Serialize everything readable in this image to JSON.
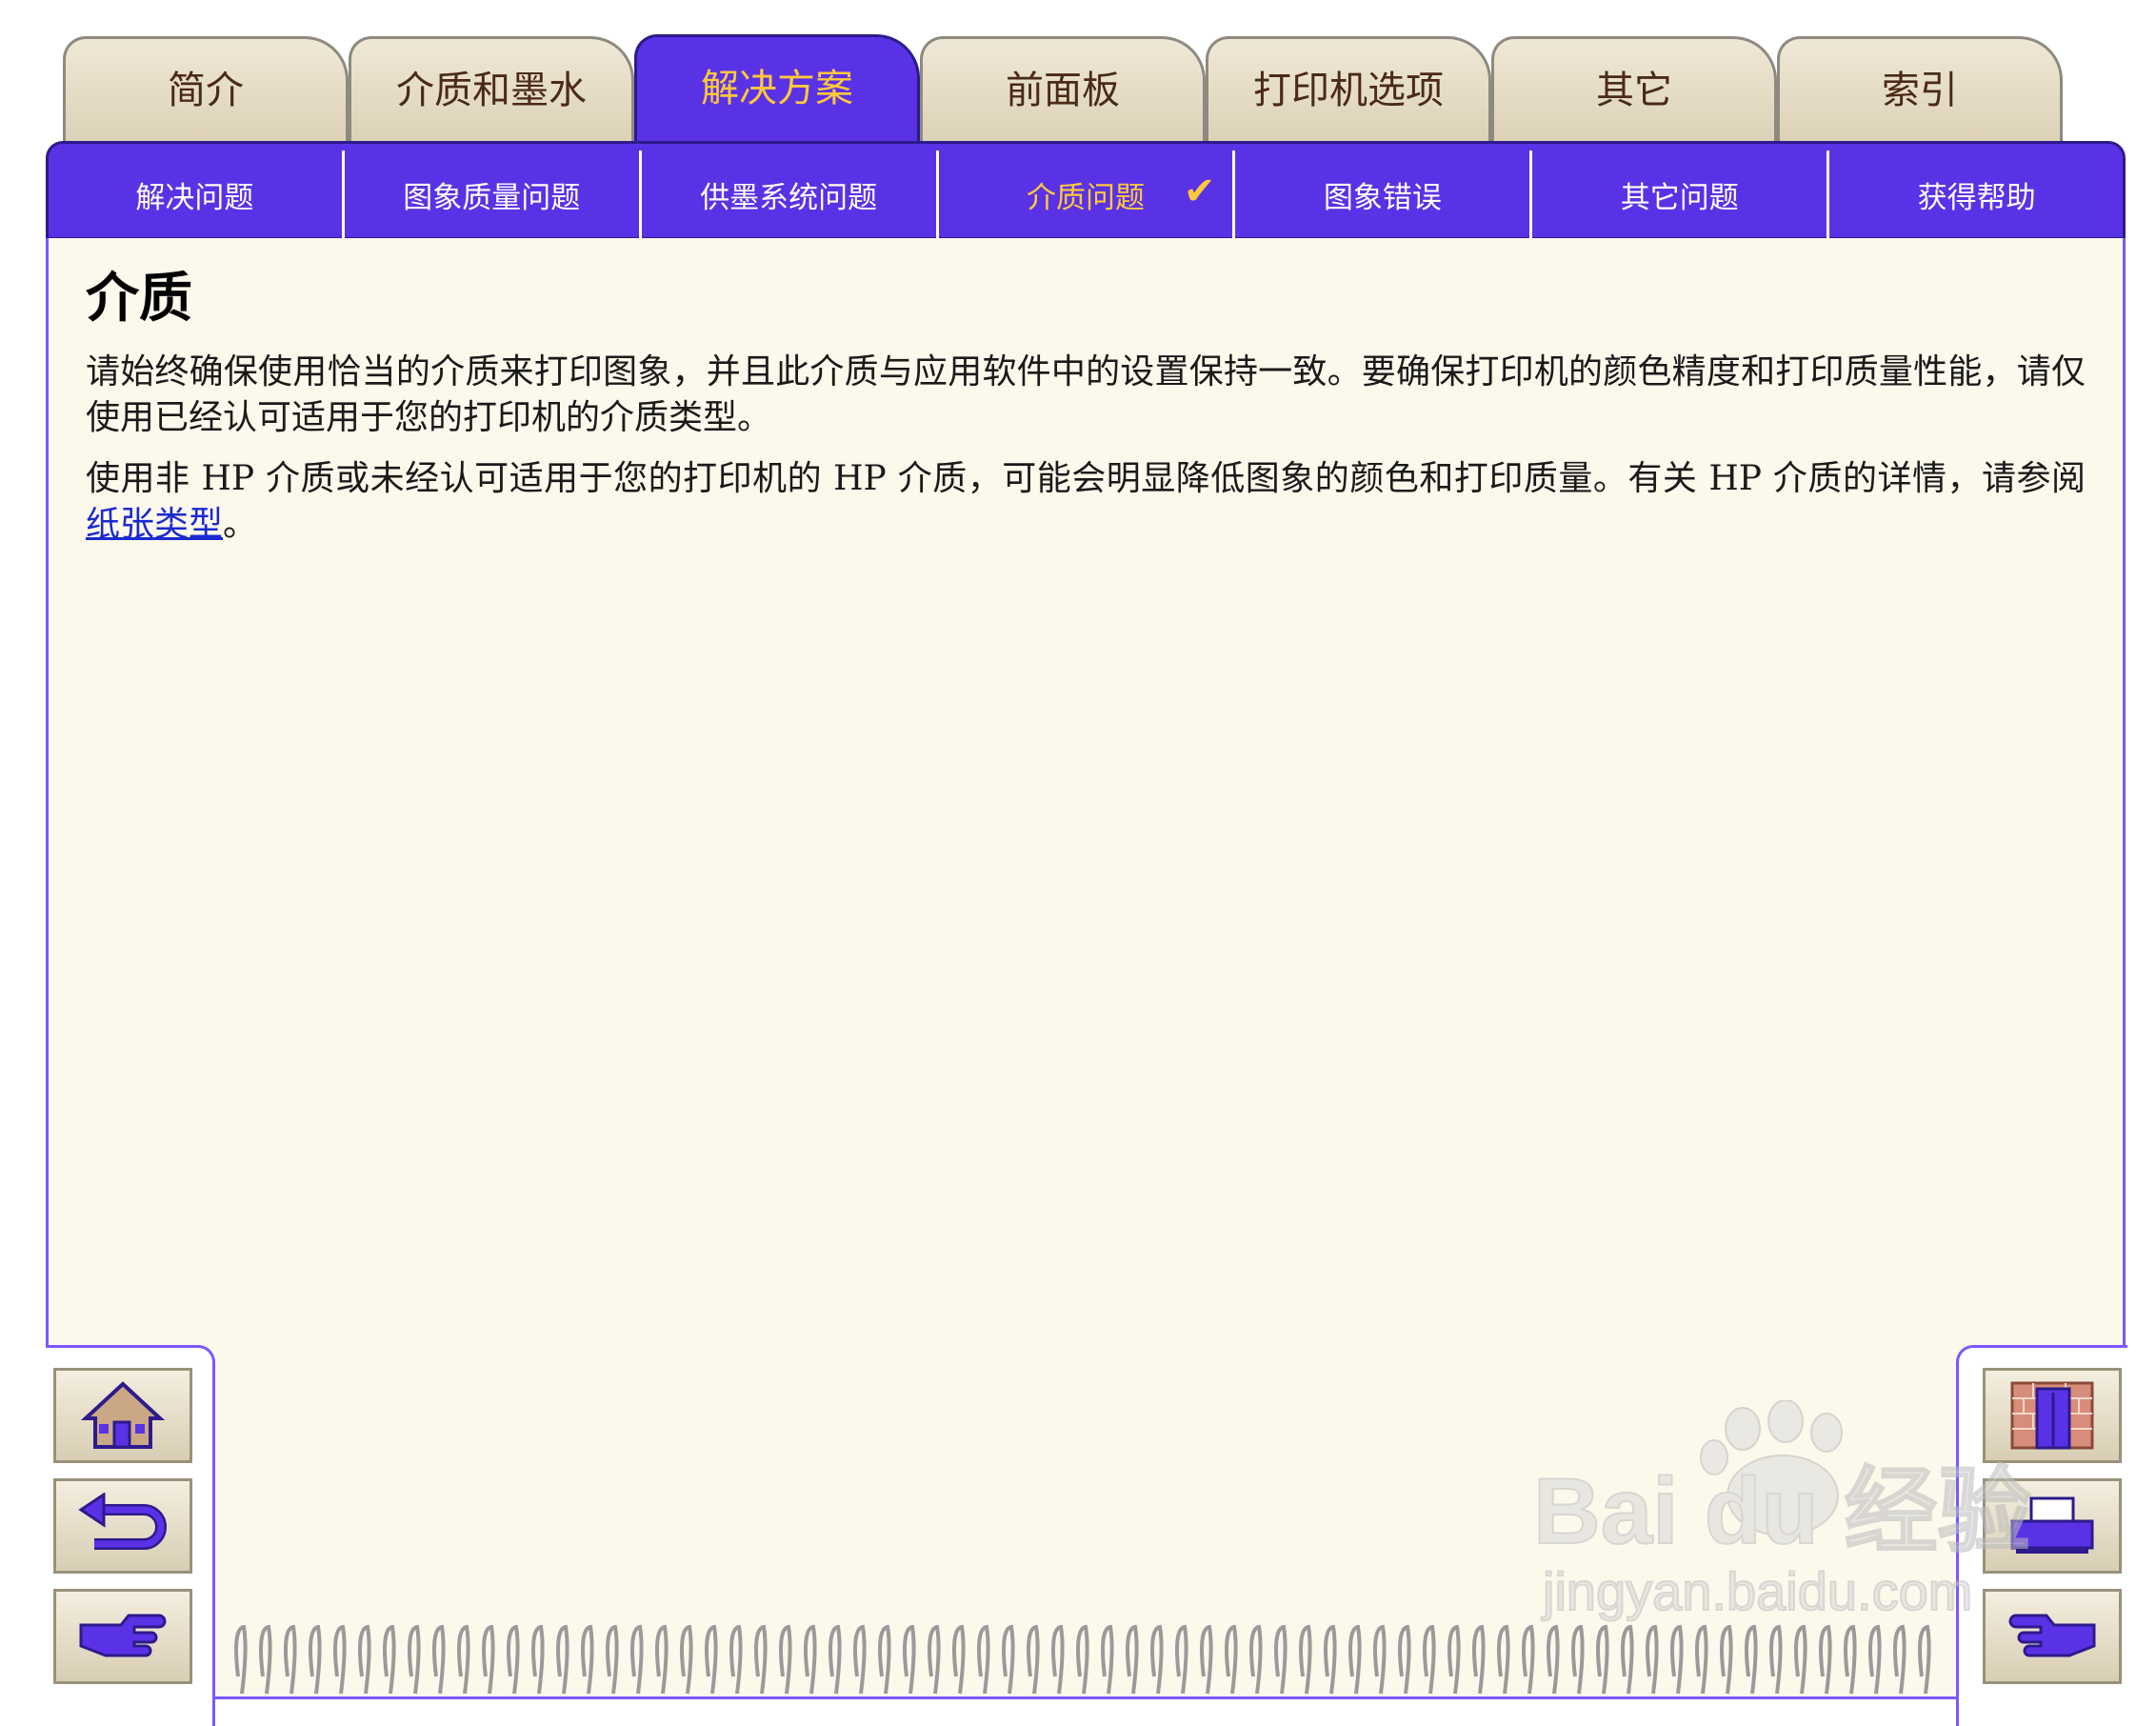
{
  "tabs": [
    {
      "label": "简介",
      "active": false
    },
    {
      "label": "介质和墨水",
      "active": false
    },
    {
      "label": "解决方案",
      "active": true
    },
    {
      "label": "前面板",
      "active": false
    },
    {
      "label": "打印机选项",
      "active": false
    },
    {
      "label": "其它",
      "active": false
    },
    {
      "label": "索引",
      "active": false
    }
  ],
  "subtabs": [
    {
      "label": "解决问题",
      "active": false
    },
    {
      "label": "图象质量问题",
      "active": false
    },
    {
      "label": "供墨系统问题",
      "active": false
    },
    {
      "label": "介质问题",
      "active": true,
      "check": "✔"
    },
    {
      "label": "图象错误",
      "active": false
    },
    {
      "label": "其它问题",
      "active": false
    },
    {
      "label": "获得帮助",
      "active": false
    }
  ],
  "content": {
    "title": "介质",
    "para1": "请始终确保使用恰当的介质来打印图象，并且此介质与应用软件中的设置保持一致。要确保打印机的颜色精度和打印质量性能，请仅使用已经认可适用于您的打印机的介质类型。",
    "para2_prefix": "使用非 HP 介质或未经认可适用于您的打印机的 HP 介质，可能会明显降低图象的颜色和打印质量。有关 HP 介质的详情，请参阅",
    "para2_link": "纸张类型",
    "para2_suffix": "。"
  },
  "nav": {
    "left": [
      "home-icon",
      "back-icon",
      "next-page-icon"
    ],
    "right": [
      "exit-door-icon",
      "printer-icon",
      "previous-page-icon"
    ]
  },
  "watermark": {
    "brand": "Bai du 经验",
    "url": "jingyan.baidu.com"
  },
  "colors": {
    "tab_active_bg": "#5a32e6",
    "tab_active_text": "#ffc83a",
    "panel_bg": "#fdf8ec",
    "link": "#1a2ad0"
  }
}
